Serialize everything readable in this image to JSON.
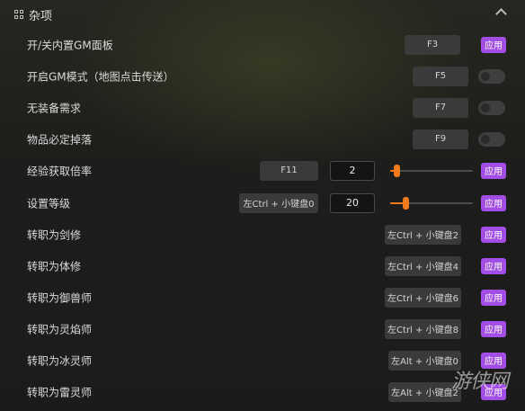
{
  "section": {
    "title": "杂项",
    "icon": "grid-icon",
    "chevron": "chevron-up-icon"
  },
  "apply_label": "应用",
  "accent_color": "#a24ee6",
  "slider_color": "#f07a1c",
  "rows": [
    {
      "label": "开/关内置GM面板",
      "hotkey": "F3",
      "control": "apply"
    },
    {
      "label": "开启GM模式（地图点击传送）",
      "hotkey": "F5",
      "control": "toggle",
      "state": "off"
    },
    {
      "label": "无装备需求",
      "hotkey": "F7",
      "control": "toggle",
      "state": "off"
    },
    {
      "label": "物品必定掉落",
      "hotkey": "F9",
      "control": "toggle",
      "state": "off"
    },
    {
      "label": "经验获取倍率",
      "hotkey": "F11",
      "control": "slider_apply",
      "value": "2",
      "slider_fraction": 0.08
    },
    {
      "label": "设置等级",
      "hotkey": "左Ctrl + 小键盘0",
      "control": "slider_apply",
      "value": "20",
      "slider_fraction": 0.18
    },
    {
      "label": "转职为剑修",
      "hotkey": "左Ctrl + 小键盘2",
      "control": "apply"
    },
    {
      "label": "转职为体修",
      "hotkey": "左Ctrl + 小键盘4",
      "control": "apply"
    },
    {
      "label": "转职为御兽师",
      "hotkey": "左Ctrl + 小键盘6",
      "control": "apply"
    },
    {
      "label": "转职为灵焰师",
      "hotkey": "左Ctrl + 小键盘8",
      "control": "apply"
    },
    {
      "label": "转职为冰灵师",
      "hotkey": "左Alt + 小键盘0",
      "control": "apply"
    },
    {
      "label": "转职为雷灵师",
      "hotkey": "左Alt + 小键盘2",
      "control": "apply"
    }
  ],
  "watermark": "游侠网"
}
